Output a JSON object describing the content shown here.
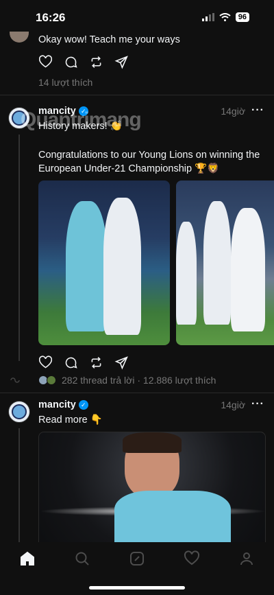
{
  "status": {
    "time": "16:26",
    "battery": "96"
  },
  "post_top": {
    "caption": "Okay wow! Teach me your ways",
    "likes": "14 lượt thích"
  },
  "post1": {
    "username": "mancity",
    "time": "14giờ",
    "line1": "History makers! 👏",
    "line2": "Congratulations to our Young Lions on winning the European Under-21 Championship 🏆🦁",
    "replies": "282 thread trả lời · 12.886 lượt thích"
  },
  "post2": {
    "username": "mancity",
    "time": "14giờ",
    "line1": "Read more 👇"
  },
  "watermark": "Quantrimang",
  "icons": {
    "like": "heart-icon",
    "reply": "comment-icon",
    "repost": "repost-icon",
    "share": "send-icon",
    "home": "home-icon",
    "search": "search-icon",
    "compose": "compose-icon",
    "activity": "heart-icon",
    "profile": "profile-icon"
  },
  "colors": {
    "background": "#101010",
    "verified": "#0095f6",
    "muted": "#777777"
  }
}
